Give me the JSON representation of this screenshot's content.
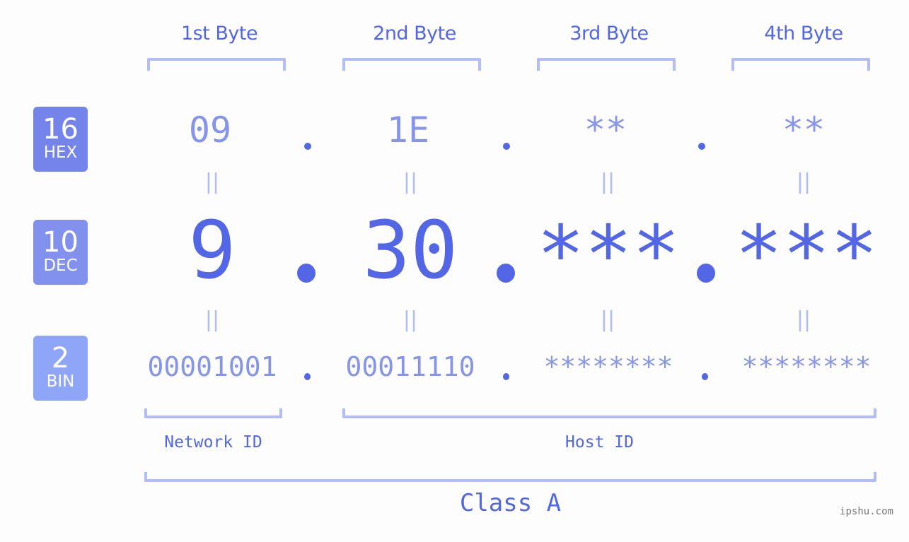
{
  "byte_headers": [
    "1st Byte",
    "2nd Byte",
    "3rd Byte",
    "4th Byte"
  ],
  "badges": [
    {
      "number": "16",
      "label": "HEX",
      "color": "#7584ea"
    },
    {
      "number": "10",
      "label": "DEC",
      "color": "#8290ee"
    },
    {
      "number": "2",
      "label": "BIN",
      "color": "#8fa5f8"
    }
  ],
  "hex": [
    "09",
    "1E",
    "**",
    "**"
  ],
  "dec": [
    "9",
    "30",
    "***",
    "***"
  ],
  "bin": [
    "00001001",
    "00011110",
    "********",
    "********"
  ],
  "equals_symbol": "||",
  "separator": ".",
  "segments": {
    "network_id": "Network ID",
    "host_id": "Host ID"
  },
  "class_label": "Class A",
  "watermark": "ipshu.com",
  "colors": {
    "primary": "#5366e6",
    "secondary": "#8794ec",
    "bracket": "#b2bdf5",
    "background": "#fcfdfc"
  }
}
